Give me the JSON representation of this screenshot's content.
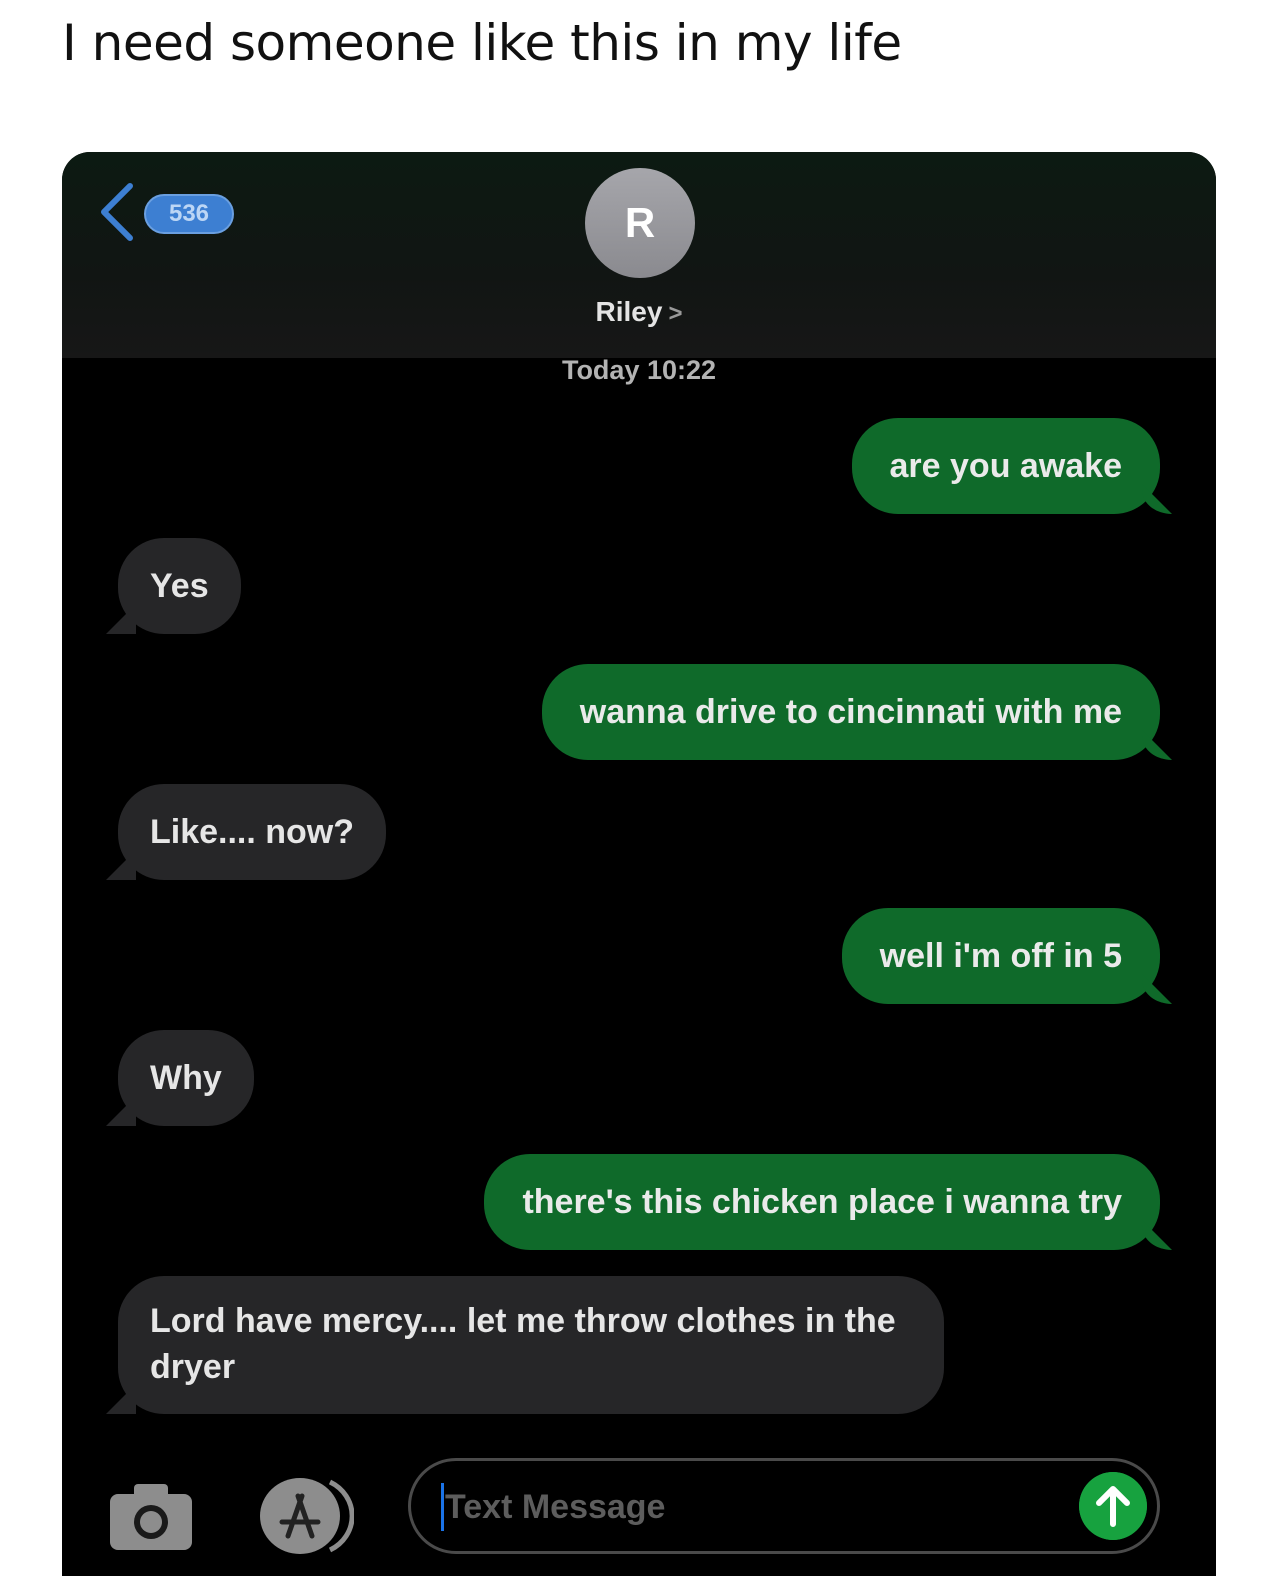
{
  "post": {
    "caption": "I need someone like this in my life"
  },
  "header": {
    "back_badge": "536",
    "avatar_initial": "R",
    "contact_name": "Riley",
    "contact_chevron": ">",
    "timestamp": "Today 10:22"
  },
  "messages": [
    {
      "side": "sent",
      "text": "are you awake"
    },
    {
      "side": "received",
      "text": "Yes"
    },
    {
      "side": "sent",
      "text": "wanna drive to cincinnati with me"
    },
    {
      "side": "received",
      "text": "Like.... now?"
    },
    {
      "side": "sent",
      "text": "well i'm off in 5"
    },
    {
      "side": "received",
      "text": "Why"
    },
    {
      "side": "sent",
      "text": "there's this chicken place i wanna try"
    },
    {
      "side": "received",
      "text": "Lord have mercy.... let me throw clothes in the dryer"
    }
  ],
  "composer": {
    "placeholder": "Text Message",
    "icons": [
      "camera-icon",
      "app-store-icon",
      "send-arrow-icon"
    ]
  },
  "colors": {
    "sent_bubble": "#0f6a2a",
    "received_bubble": "#262628",
    "send_button": "#17a23f",
    "badge": "#3d7fd2"
  }
}
